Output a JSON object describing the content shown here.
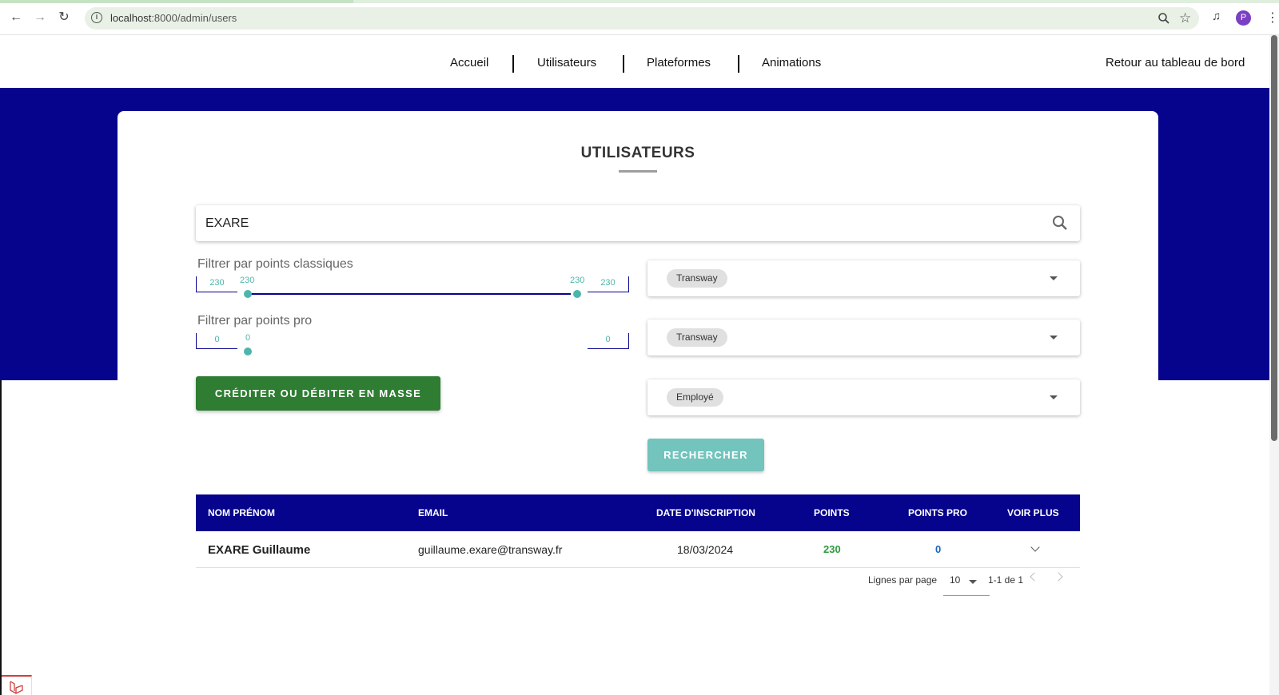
{
  "browser": {
    "url_host": "localhost",
    "url_path": ":8000/admin/users",
    "profile_initial": "P"
  },
  "nav": {
    "items": [
      "Accueil",
      "Utilisateurs",
      "Plateformes",
      "Animations"
    ],
    "dashboard_link": "Retour au tableau de bord"
  },
  "page": {
    "title": "UTILISATEURS",
    "search_value": "EXARE"
  },
  "filters": {
    "classic": {
      "label": "Filtrer par points classiques",
      "min": "230",
      "max": "230",
      "low_thumb": "230",
      "high_thumb": "230"
    },
    "pro": {
      "label": "Filtrer par points pro",
      "min": "0",
      "max": "0",
      "thumb": "0"
    }
  },
  "selects": [
    {
      "chip": "Transway"
    },
    {
      "chip": "Transway"
    },
    {
      "chip": "Employé"
    }
  ],
  "buttons": {
    "mass": "CRÉDITER OU DÉBITER EN MASSE",
    "search": "RECHERCHER"
  },
  "table": {
    "headers": [
      "NOM PRÉNOM",
      "EMAIL",
      "DATE D'INSCRIPTION",
      "POINTS",
      "POINTS PRO",
      "VOIR PLUS"
    ],
    "rows": [
      {
        "name": "EXARE Guillaume",
        "email": "guillaume.exare@transway.fr",
        "date": "18/03/2024",
        "points": "230",
        "points_pro": "0"
      }
    ]
  },
  "pagination": {
    "rows_label": "Lignes par page",
    "rows_value": "10",
    "range": "1-1 de 1"
  },
  "colors": {
    "brand_blue": "#06038d",
    "green": "#2e7d32",
    "teal": "#72c4bd",
    "points_green": "#2e9a3e",
    "points_pro_blue": "#1565c0"
  }
}
